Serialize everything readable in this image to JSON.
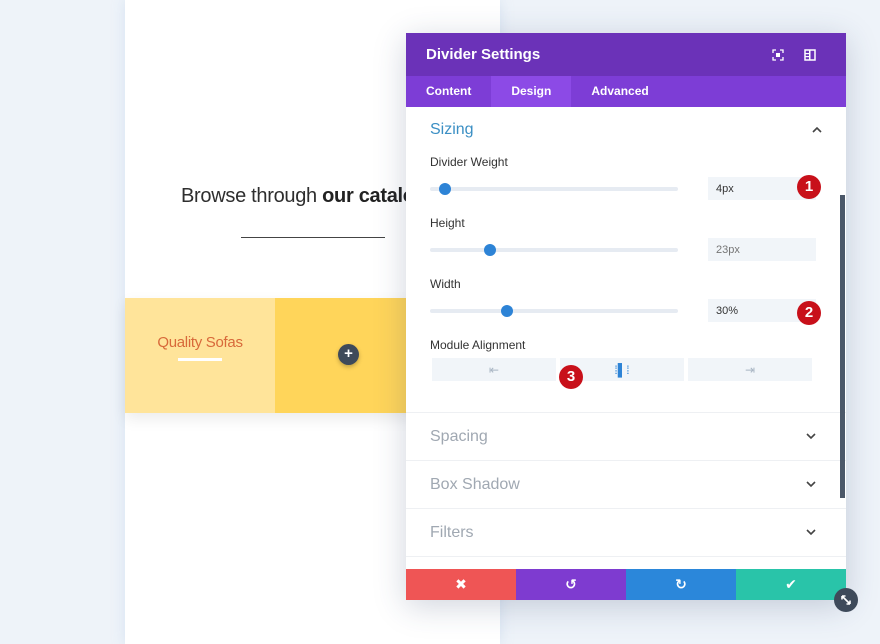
{
  "page": {
    "headline_plain": "Browse through ",
    "headline_bold": "our catalo",
    "product_title": "Quality Sofas",
    "add_module_glyph": "+"
  },
  "modal": {
    "title": "Divider Settings",
    "header_icons": [
      "focus-icon",
      "sidebar-layout-icon"
    ],
    "tabs": [
      {
        "label": "Content",
        "active": false
      },
      {
        "label": "Design",
        "active": true
      },
      {
        "label": "Advanced",
        "active": false
      }
    ],
    "sizing": {
      "title": "Sizing",
      "expanded": true,
      "divider_weight": {
        "label": "Divider Weight",
        "value": "4px",
        "slider_fraction": 0.06,
        "badge": "1"
      },
      "height": {
        "label": "Height",
        "placeholder": "23px",
        "slider_fraction": 0.24
      },
      "width": {
        "label": "Width",
        "value": "30%",
        "slider_fraction": 0.31,
        "badge": "2"
      },
      "module_alignment": {
        "label": "Module Alignment",
        "options": [
          {
            "name": "left",
            "glyph": "⇤",
            "active": false
          },
          {
            "name": "center",
            "glyph": "⁞▌⁞",
            "active": true
          },
          {
            "name": "right",
            "glyph": "⇥",
            "active": false
          }
        ],
        "badge": "3"
      }
    },
    "collapsed_sections": [
      {
        "title": "Spacing"
      },
      {
        "title": "Box Shadow"
      },
      {
        "title": "Filters"
      }
    ],
    "footer": {
      "cancel": {
        "glyph": "✖",
        "color": "#ef5555"
      },
      "undo": {
        "glyph": "↺",
        "color": "#7e3bd0"
      },
      "redo": {
        "glyph": "↻",
        "color": "#2b87da"
      },
      "save": {
        "glyph": "✔",
        "color": "#29c4a9"
      }
    }
  },
  "colors": {
    "header": "#6b32b8",
    "tabs": "#7d3dd6",
    "accent_blue": "#2d83d6",
    "badge_red": "#c8101a"
  }
}
